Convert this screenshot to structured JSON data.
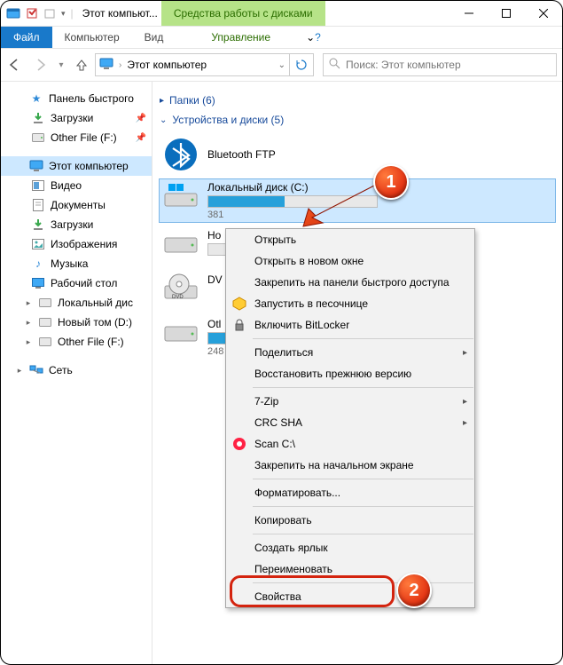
{
  "titlebar": {
    "title": "Этот компьют...",
    "context_title": "Средства работы с дисками"
  },
  "ribbon": {
    "file": "Файл",
    "computer": "Компьютер",
    "view": "Вид",
    "manage": "Управление"
  },
  "nav": {
    "location": "Этот компьютер",
    "search_placeholder": "Поиск: Этот компьютер"
  },
  "sidebar": {
    "quick_access": "Панель быстрого",
    "downloads": "Загрузки",
    "other_file": "Other File (F:)",
    "this_pc": "Этот компьютер",
    "videos": "Видео",
    "documents": "Документы",
    "downloads2": "Загрузки",
    "pictures": "Изображения",
    "music": "Музыка",
    "desktop": "Рабочий стол",
    "local_disk": "Локальный дис",
    "new_vol": "Новый том (D:)",
    "other_file2": "Other File (F:)",
    "network": "Сеть"
  },
  "groups": {
    "folders": "Папки (6)",
    "devices": "Устройства и диски (5)"
  },
  "items": {
    "bluetooth": "Bluetooth FTP",
    "drive_c": {
      "name": "Локальный диск (C:)",
      "sub": "381",
      "fill": 45
    },
    "drive_h": {
      "name": "Но",
      "sub": ""
    },
    "dvd": {
      "name": "DV"
    },
    "other": {
      "name": "Otl",
      "sub": "248",
      "fill": 18
    }
  },
  "ctx": {
    "open": "Открыть",
    "open_new": "Открыть в новом окне",
    "pin_qa": "Закрепить на панели быстрого доступа",
    "sandbox": "Запустить в песочнице",
    "bitlocker": "Включить BitLocker",
    "share": "Поделиться",
    "restore": "Восстановить прежнюю версию",
    "sevenzip": "7-Zip",
    "crc": "CRC SHA",
    "scan": "Scan C:\\",
    "pin_start": "Закрепить на начальном экране",
    "format": "Форматировать...",
    "copy": "Копировать",
    "shortcut": "Создать ярлык",
    "rename": "Переименовать",
    "properties": "Свойства"
  },
  "callouts": {
    "one": "1",
    "two": "2"
  }
}
